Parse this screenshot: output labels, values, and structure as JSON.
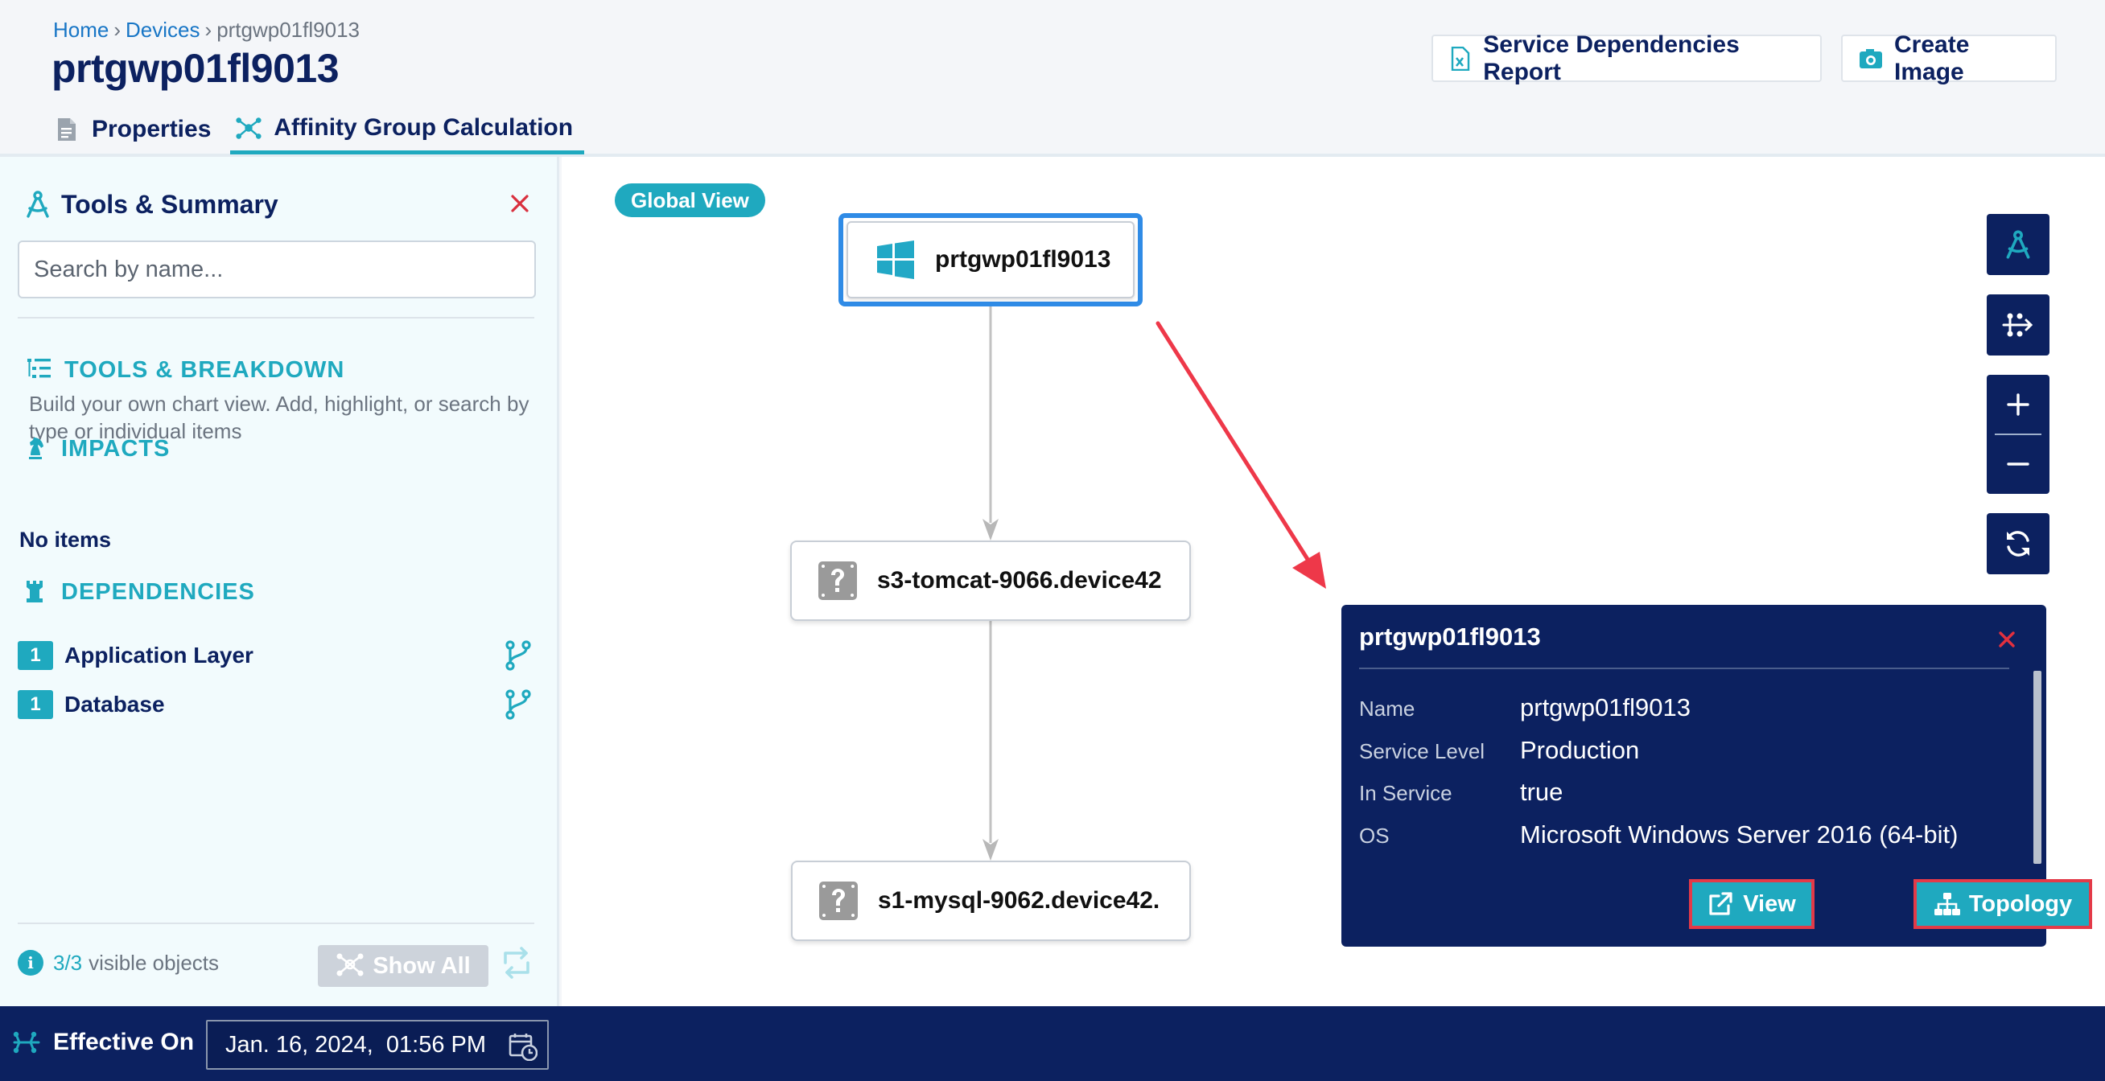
{
  "breadcrumb": {
    "home": "Home",
    "devices": "Devices",
    "current": "prtgwp01fl9013",
    "sep": "›"
  },
  "page_title": "prtgwp01fl9013",
  "tabs": [
    {
      "label": "Properties",
      "icon": "document-icon"
    },
    {
      "label": "Affinity Group Calculation",
      "icon": "network-icon",
      "active": true
    }
  ],
  "header_buttons": {
    "report": "Service Dependencies Report",
    "create_image": "Create Image"
  },
  "sidebar": {
    "title": "Tools & Summary",
    "search_placeholder": "Search by name...",
    "tools_heading": "TOOLS & BREAKDOWN",
    "tools_desc": "Build your own chart view. Add, highlight, or search by type or individual items",
    "impacts_heading": "IMPACTS",
    "impacts_empty": "No items",
    "dependencies_heading": "DEPENDENCIES",
    "dependencies": [
      {
        "count": "1",
        "label": "Application Layer"
      },
      {
        "count": "1",
        "label": "Database"
      }
    ],
    "visible_count": "3/3",
    "visible_label": "visible objects",
    "show_all": "Show All"
  },
  "canvas": {
    "view_badge": "Global View",
    "nodes": [
      {
        "label": "prtgwp01fl9013",
        "icon": "windows-icon",
        "selected": true
      },
      {
        "label": "s3-tomcat-9066.device42",
        "icon": "unknown-device-icon"
      },
      {
        "label": "s1-mysql-9062.device42.",
        "icon": "unknown-device-icon"
      }
    ]
  },
  "popup": {
    "title": "prtgwp01fl9013",
    "properties": [
      {
        "key": "Name",
        "value": "prtgwp01fl9013"
      },
      {
        "key": "Service Level",
        "value": "Production"
      },
      {
        "key": "In Service",
        "value": "true"
      },
      {
        "key": "OS",
        "value": "Microsoft Windows Server 2016 (64-bit)"
      }
    ],
    "view_button": "View",
    "topology_button": "Topology"
  },
  "bottom_bar": {
    "effective_label": "Effective On",
    "date_value": "Jan. 16, 2024,  01:56 PM"
  },
  "colors": {
    "navy": "#0c2160",
    "teal": "#1fa9bf",
    "selection_blue": "#2f8be6",
    "highlight_red": "#e33a48"
  }
}
